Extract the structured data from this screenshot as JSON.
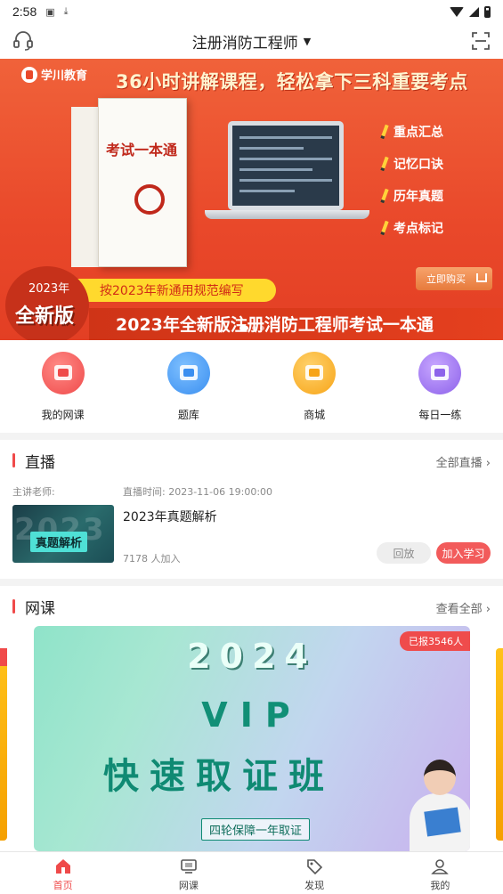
{
  "status_bar": {
    "time": "2:58"
  },
  "header": {
    "title": "注册消防工程师",
    "caret": "▼"
  },
  "banner": {
    "logo": "学川教育",
    "headline": "36小时讲解课程，轻松拿下三科重要考点",
    "book_title": "考试一本通",
    "features": [
      "重点汇总",
      "记忆口诀",
      "历年真题",
      "考点标记"
    ],
    "buy_label": "立即购买",
    "tag": "按2023年新通用规范编写",
    "badge_year": "2023年",
    "badge_new": "全新版",
    "bottom_title": "2023年全新版注册消防工程师考试一本通"
  },
  "quick_entries": [
    {
      "label": "我的网课",
      "color": "#ef4a4a"
    },
    {
      "label": "题库",
      "color": "#3b8ff0"
    },
    {
      "label": "商城",
      "color": "#f7a417"
    },
    {
      "label": "每日一练",
      "color": "#8d62ea"
    }
  ],
  "live": {
    "title": "直播",
    "more": "全部直播 ›",
    "teacher_label": "主讲老师:",
    "time_label": "直播时间: 2023-11-06 19:00:00",
    "thumb_big": "2023",
    "thumb_pill": "真题解析",
    "item_title": "2023年真题解析",
    "count": "7178 人加入",
    "replay": "回放",
    "join": "加入学习"
  },
  "course": {
    "title": "网课",
    "more": "查看全部 ›",
    "ribbon": "已报3546人",
    "year": "2024",
    "vip": "VIP",
    "name": "快速取证班",
    "sub": "四轮保障一年取证"
  },
  "tabbar": [
    {
      "label": "首页",
      "active": true
    },
    {
      "label": "网课",
      "active": false
    },
    {
      "label": "发现",
      "active": false
    },
    {
      "label": "我的",
      "active": false
    }
  ]
}
